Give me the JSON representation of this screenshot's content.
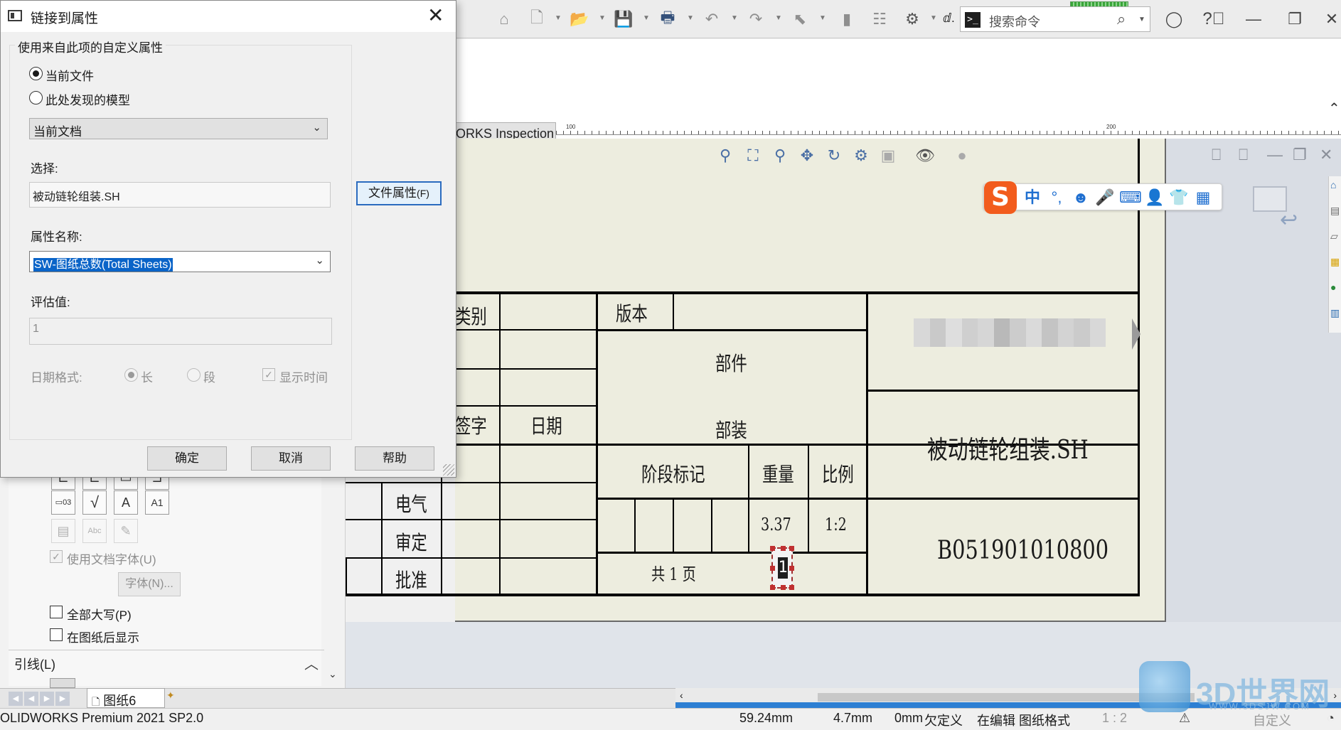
{
  "dialog": {
    "title": "链接到属性",
    "group_label": "使用来自此项的自定义属性",
    "radio_current_file": "当前文件",
    "radio_model_found": "此处发现的模型",
    "source_combo": "当前文档",
    "select_label": "选择:",
    "select_value": "被动链轮组装.SH",
    "file_props_button": "文件属性",
    "file_props_accel": "(F)",
    "prop_name_label": "属性名称:",
    "prop_name_value": "SW-图纸总数(Total Sheets)",
    "eval_label": "评估值:",
    "eval_value": "1",
    "date_format_label": "日期格式:",
    "date_long": "长",
    "date_short": "段",
    "show_time": "显示时间",
    "ok": "确定",
    "cancel": "取消",
    "help": "帮助"
  },
  "toolbar": {
    "search_placeholder": "搜索命令",
    "truncated_label": "ⅆ."
  },
  "inspection_tab": "ORKS Inspection",
  "ruler": {
    "label_100": "100",
    "label_200": "200"
  },
  "ime": {
    "logo": "S",
    "mode": "中",
    "punct": "°,"
  },
  "title_block": {
    "category": "类别",
    "signature": "签字",
    "date": "日期",
    "electrical": "电气",
    "review": "审定",
    "approve": "批准",
    "version": "版本",
    "part": "部件",
    "assembly": "部装",
    "stage_mark": "阶段标记",
    "weight": "重量",
    "scale": "比例",
    "weight_value": "3.37",
    "scale_value": "1:2",
    "sheets_text": "共 1 页",
    "sheet_count_value": "1",
    "drawing_name": "被动链轮组装.SH",
    "drawing_number": "B051901010800"
  },
  "left_panel": {
    "use_doc_font": "使用文档字体(U)",
    "font_button": "字体(N)...",
    "all_caps": "全部大写(P)",
    "show_behind": "在图纸后显示",
    "leader_section": "引线(L)"
  },
  "sheet_tabs": {
    "active_tab": "图纸6"
  },
  "status_bar": {
    "app_name": "OLIDWORKS Premium 2021 SP2.0",
    "x_coord": "59.24mm",
    "y_coord": "4.7mm",
    "z_coord": "0mm",
    "defined_state": "欠定义",
    "edit_mode": "在编辑 图纸格式",
    "scale": "1 : 2",
    "custom": "自定义"
  },
  "watermark": {
    "text": "3D世界网",
    "url": "WWW.3DSJW.COM"
  }
}
